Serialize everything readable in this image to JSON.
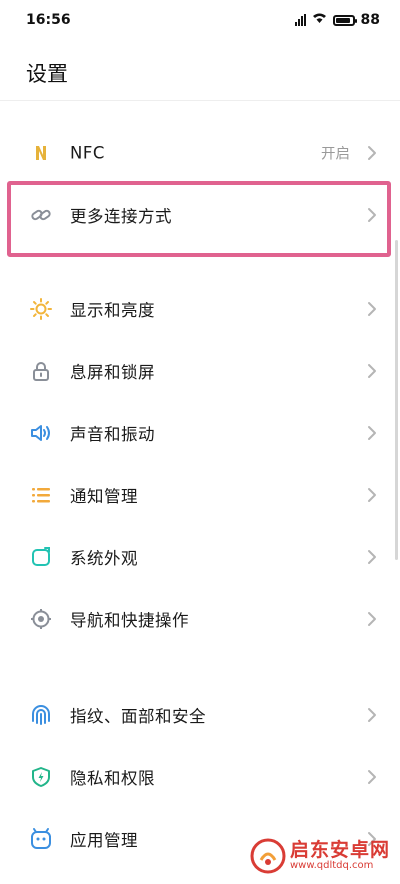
{
  "status_bar": {
    "time": "16:56",
    "battery": "88",
    "battery_level_percent": 88
  },
  "header": {
    "title": "设置"
  },
  "settings": [
    {
      "label": "NFC",
      "value": "开启",
      "icon": "nfc-icon",
      "icon_color": "#e6b23a"
    },
    {
      "label": "更多连接方式",
      "value": "",
      "icon": "link-icon",
      "icon_color": "#8a8f98",
      "highlighted": true
    },
    {
      "label": "显示和亮度",
      "value": "",
      "icon": "sun-icon",
      "icon_color": "#f2b53b"
    },
    {
      "label": "息屏和锁屏",
      "value": "",
      "icon": "lock-icon",
      "icon_color": "#8a8f98"
    },
    {
      "label": "声音和振动",
      "value": "",
      "icon": "speaker-icon",
      "icon_color": "#3b8fe0"
    },
    {
      "label": "通知管理",
      "value": "",
      "icon": "list-icon",
      "icon_color": "#f2a93b"
    },
    {
      "label": "系统外观",
      "value": "",
      "icon": "appearance-icon",
      "icon_color": "#22c3b3"
    },
    {
      "label": "导航和快捷操作",
      "value": "",
      "icon": "navigation-icon",
      "icon_color": "#8a8f98"
    },
    {
      "label": "指纹、面部和安全",
      "value": "",
      "icon": "fingerprint-icon",
      "icon_color": "#3b8fe0"
    },
    {
      "label": "隐私和权限",
      "value": "",
      "icon": "shield-icon",
      "icon_color": "#22b58a"
    },
    {
      "label": "应用管理",
      "value": "",
      "icon": "app-icon",
      "icon_color": "#3b8fe0"
    }
  ],
  "colors": {
    "highlight": "#e0628f",
    "chevron": "#b5b5b5"
  },
  "watermark": {
    "title": "启东安卓网",
    "url": "www.qdltdq.com"
  }
}
